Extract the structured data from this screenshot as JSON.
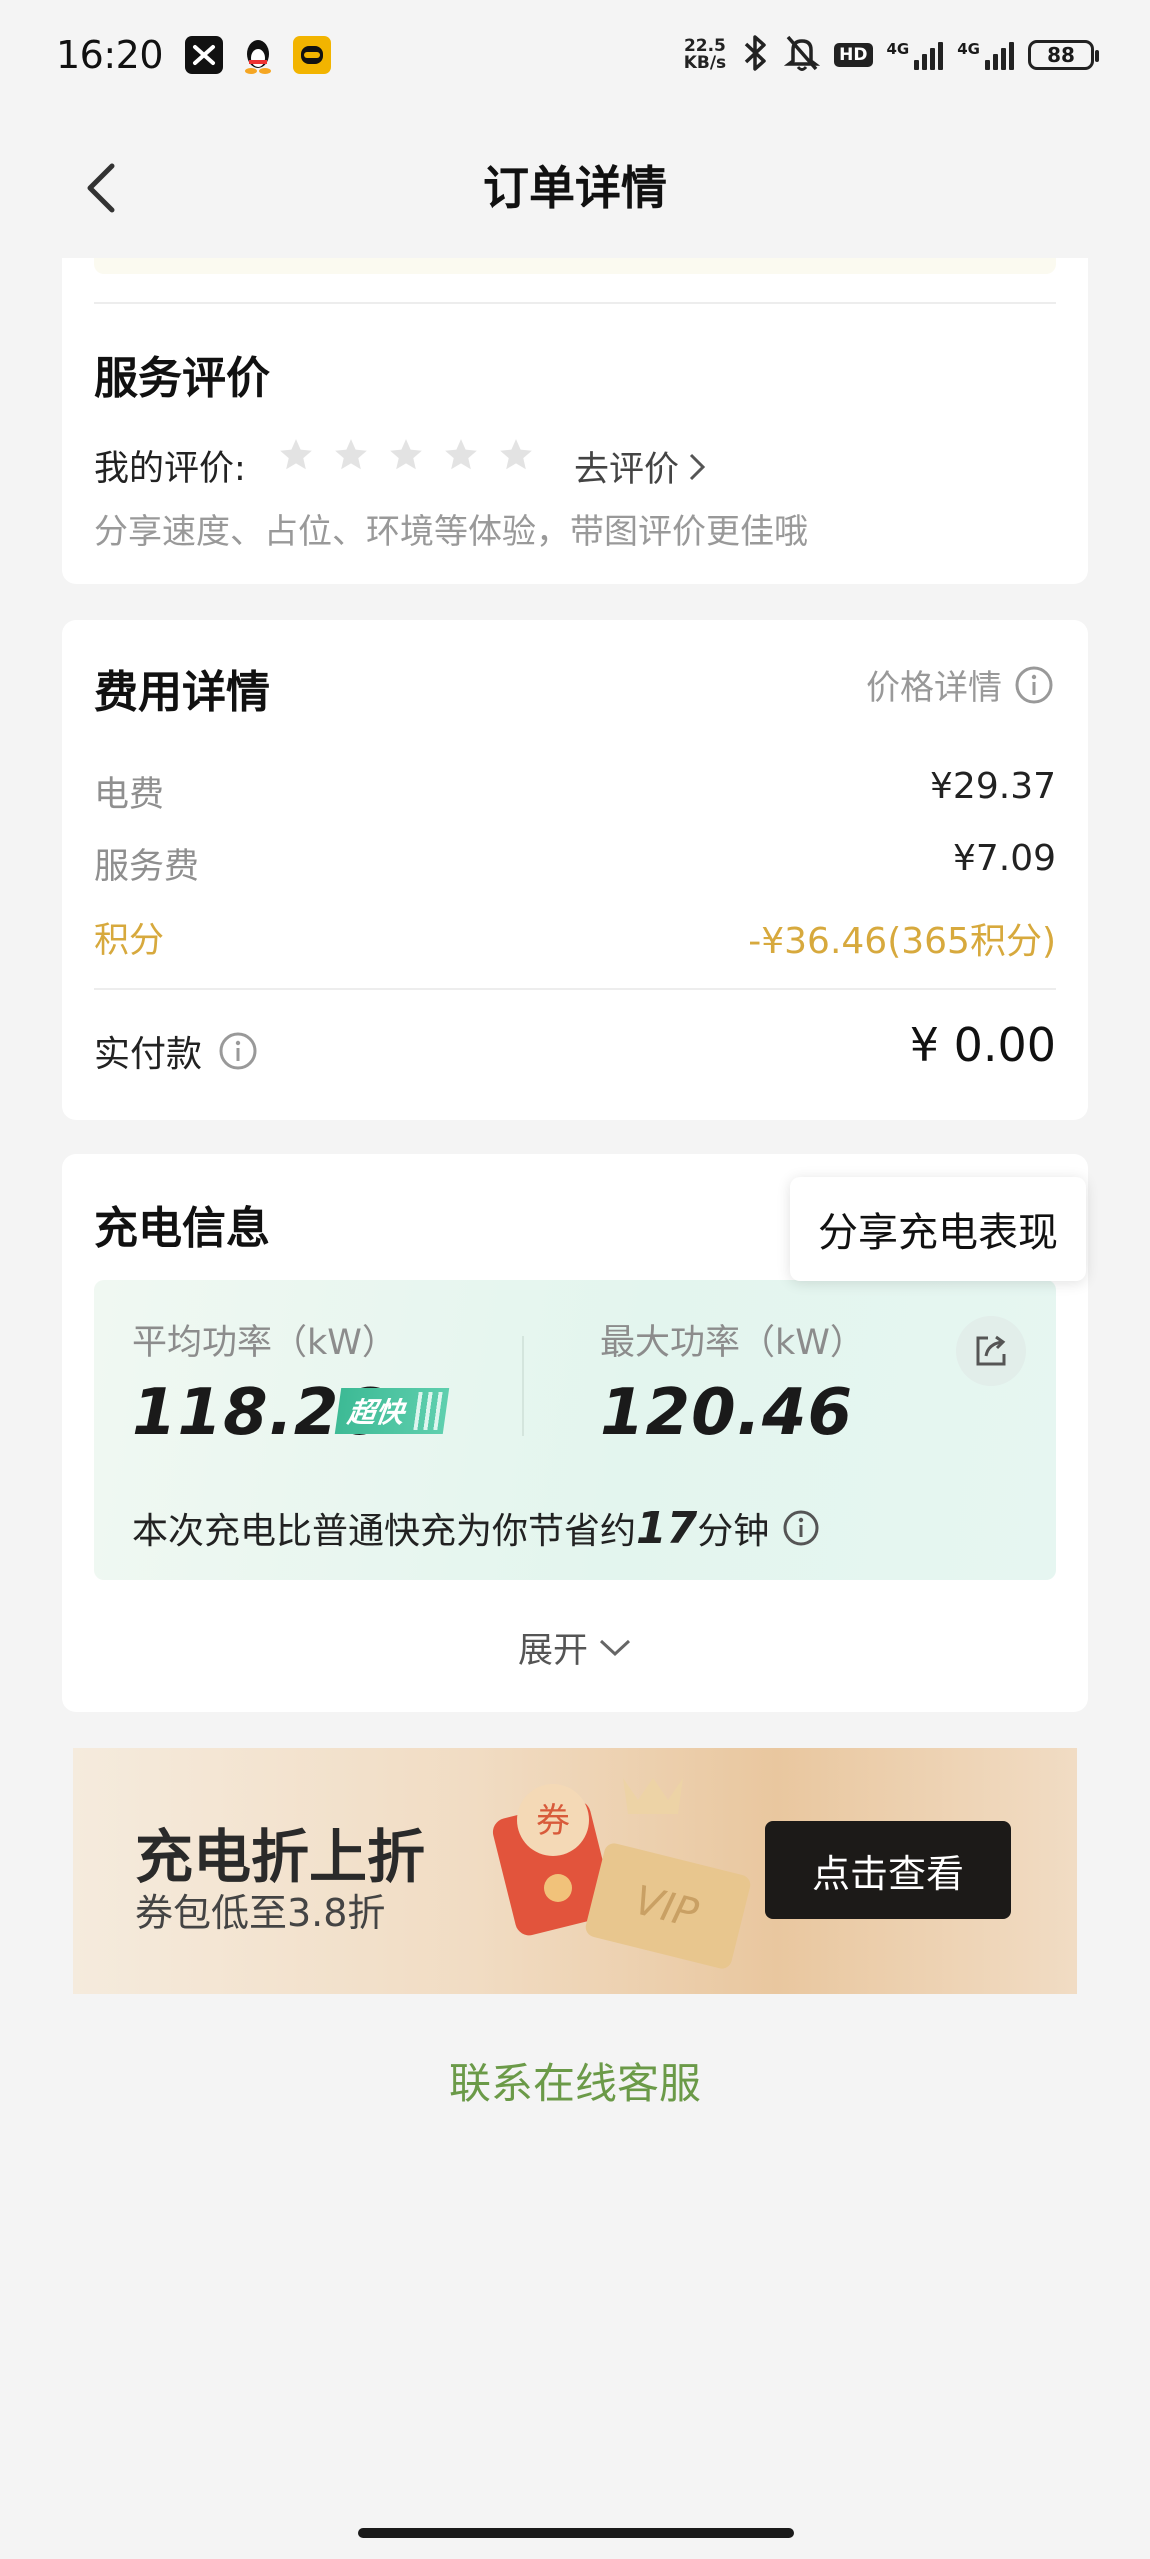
{
  "status_bar": {
    "time": "16:20",
    "net_speed_value": "22.5",
    "net_speed_unit": "KB/s",
    "hd_label": "HD",
    "signal_label_1": "4G",
    "signal_label_2": "4G",
    "battery": "88"
  },
  "header": {
    "title": "订单详情"
  },
  "review": {
    "title": "服务评价",
    "my_review_label": "我的评价:",
    "stars": 5,
    "go_review": "去评价",
    "hint": "分享速度、占位、环境等体验，带图评价更佳哦"
  },
  "cost": {
    "title": "费用详情",
    "price_detail_link": "价格详情",
    "items": [
      {
        "label": "电费",
        "value": "¥29.37"
      },
      {
        "label": "服务费",
        "value": "¥7.09"
      },
      {
        "label": "积分",
        "value": "-¥36.46(365积分)"
      }
    ],
    "paid_label": "实付款",
    "paid_value": "¥ 0.00",
    "highlight_color": "#d7a93d"
  },
  "charging": {
    "title": "充电信息",
    "share_tooltip": "分享充电表现",
    "avg_power_label": "平均功率（kW）",
    "avg_power_value": "118.26",
    "fast_badge": "超快",
    "max_power_label": "最大功率（kW）",
    "max_power_value": "120.46",
    "saving_prefix": "本次充电比普通快充为你节省约",
    "saving_minutes": "17",
    "saving_suffix": "分钟",
    "expand_label": "展开"
  },
  "banner": {
    "title": "充电折上折",
    "subtitle": "券包低至3.8折",
    "button": "点击查看",
    "coupon_char": "券",
    "vip_text": "VIP"
  },
  "footer": {
    "contact": "联系在线客服",
    "contact_color": "#6b9a48"
  }
}
